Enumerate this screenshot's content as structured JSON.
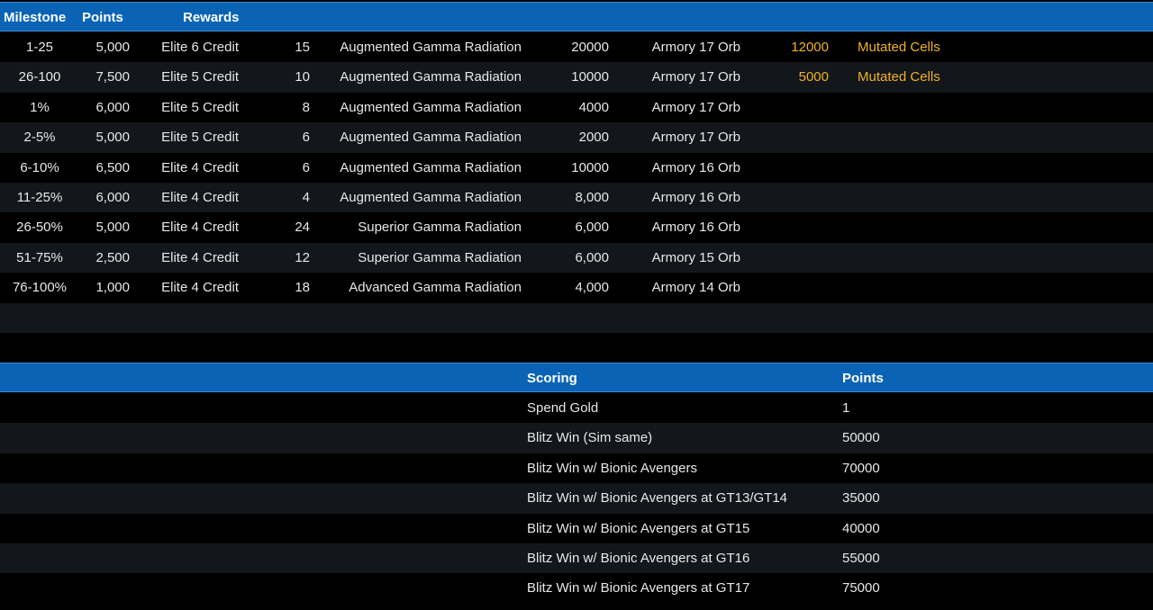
{
  "milestones": {
    "headers": {
      "milestone": "Milestone",
      "points": "Points",
      "rewards": "Rewards"
    },
    "rows": [
      {
        "milestone": "1-25",
        "points": "5,000",
        "credit": "Elite 6 Credit",
        "qty1": "15",
        "radiation": "Augmented Gamma Radiation",
        "qty2": "20000",
        "orb": "Armory 17 Orb",
        "qty3": "12000",
        "extra": "Mutated Cells"
      },
      {
        "milestone": "26-100",
        "points": "7,500",
        "credit": "Elite 5 Credit",
        "qty1": "10",
        "radiation": "Augmented Gamma Radiation",
        "qty2": "10000",
        "orb": "Armory 17 Orb",
        "qty3": "5000",
        "extra": "Mutated Cells"
      },
      {
        "milestone": "1%",
        "points": "6,000",
        "credit": "Elite 5 Credit",
        "qty1": "8",
        "radiation": "Augmented Gamma Radiation",
        "qty2": "4000",
        "orb": "Armory 17 Orb",
        "qty3": "",
        "extra": ""
      },
      {
        "milestone": "2-5%",
        "points": "5,000",
        "credit": "Elite 5 Credit",
        "qty1": "6",
        "radiation": "Augmented Gamma Radiation",
        "qty2": "2000",
        "orb": "Armory 17 Orb",
        "qty3": "",
        "extra": ""
      },
      {
        "milestone": "6-10%",
        "points": "6,500",
        "credit": "Elite 4 Credit",
        "qty1": "6",
        "radiation": "Augmented Gamma Radiation",
        "qty2": "10000",
        "orb": "Armory 16 Orb",
        "qty3": "",
        "extra": ""
      },
      {
        "milestone": "11-25%",
        "points": "6,000",
        "credit": "Elite 4 Credit",
        "qty1": "4",
        "radiation": "Augmented Gamma Radiation",
        "qty2": "8,000",
        "orb": "Armory 16 Orb",
        "qty3": "",
        "extra": ""
      },
      {
        "milestone": "26-50%",
        "points": "5,000",
        "credit": "Elite 4 Credit",
        "qty1": "24",
        "radiation": "Superior Gamma Radiation",
        "qty2": "6,000",
        "orb": "Armory 16 Orb",
        "qty3": "",
        "extra": ""
      },
      {
        "milestone": "51-75%",
        "points": "2,500",
        "credit": "Elite 4 Credit",
        "qty1": "12",
        "radiation": "Superior Gamma Radiation",
        "qty2": "6,000",
        "orb": "Armory 15 Orb",
        "qty3": "",
        "extra": ""
      },
      {
        "milestone": "76-100%",
        "points": "1,000",
        "credit": "Elite 4 Credit",
        "qty1": "18",
        "radiation": "Advanced Gamma Radiation",
        "qty2": "4,000",
        "orb": "Armory 14 Orb",
        "qty3": "",
        "extra": ""
      }
    ]
  },
  "scoring": {
    "headers": {
      "scoring": "Scoring",
      "points": "Points"
    },
    "rows": [
      {
        "label": "Spend Gold",
        "points": "1"
      },
      {
        "label": "Blitz Win (Sim same)",
        "points": "50000"
      },
      {
        "label": "Blitz Win w/ Bionic Avengers",
        "points": "70000"
      },
      {
        "label": "Blitz Win w/ Bionic Avengers at GT13/GT14",
        "points": "35000"
      },
      {
        "label": "Blitz Win w/ Bionic Avengers at GT15",
        "points": "40000"
      },
      {
        "label": "Blitz Win w/ Bionic Avengers at GT16",
        "points": "55000"
      },
      {
        "label": "Blitz Win w/ Bionic Avengers at GT17",
        "points": "75000"
      }
    ]
  },
  "colors": {
    "header_bg": "#0a63b5",
    "row_dark": "#000000",
    "row_alt": "#13161b",
    "highlight_gold": "#f0b224"
  }
}
